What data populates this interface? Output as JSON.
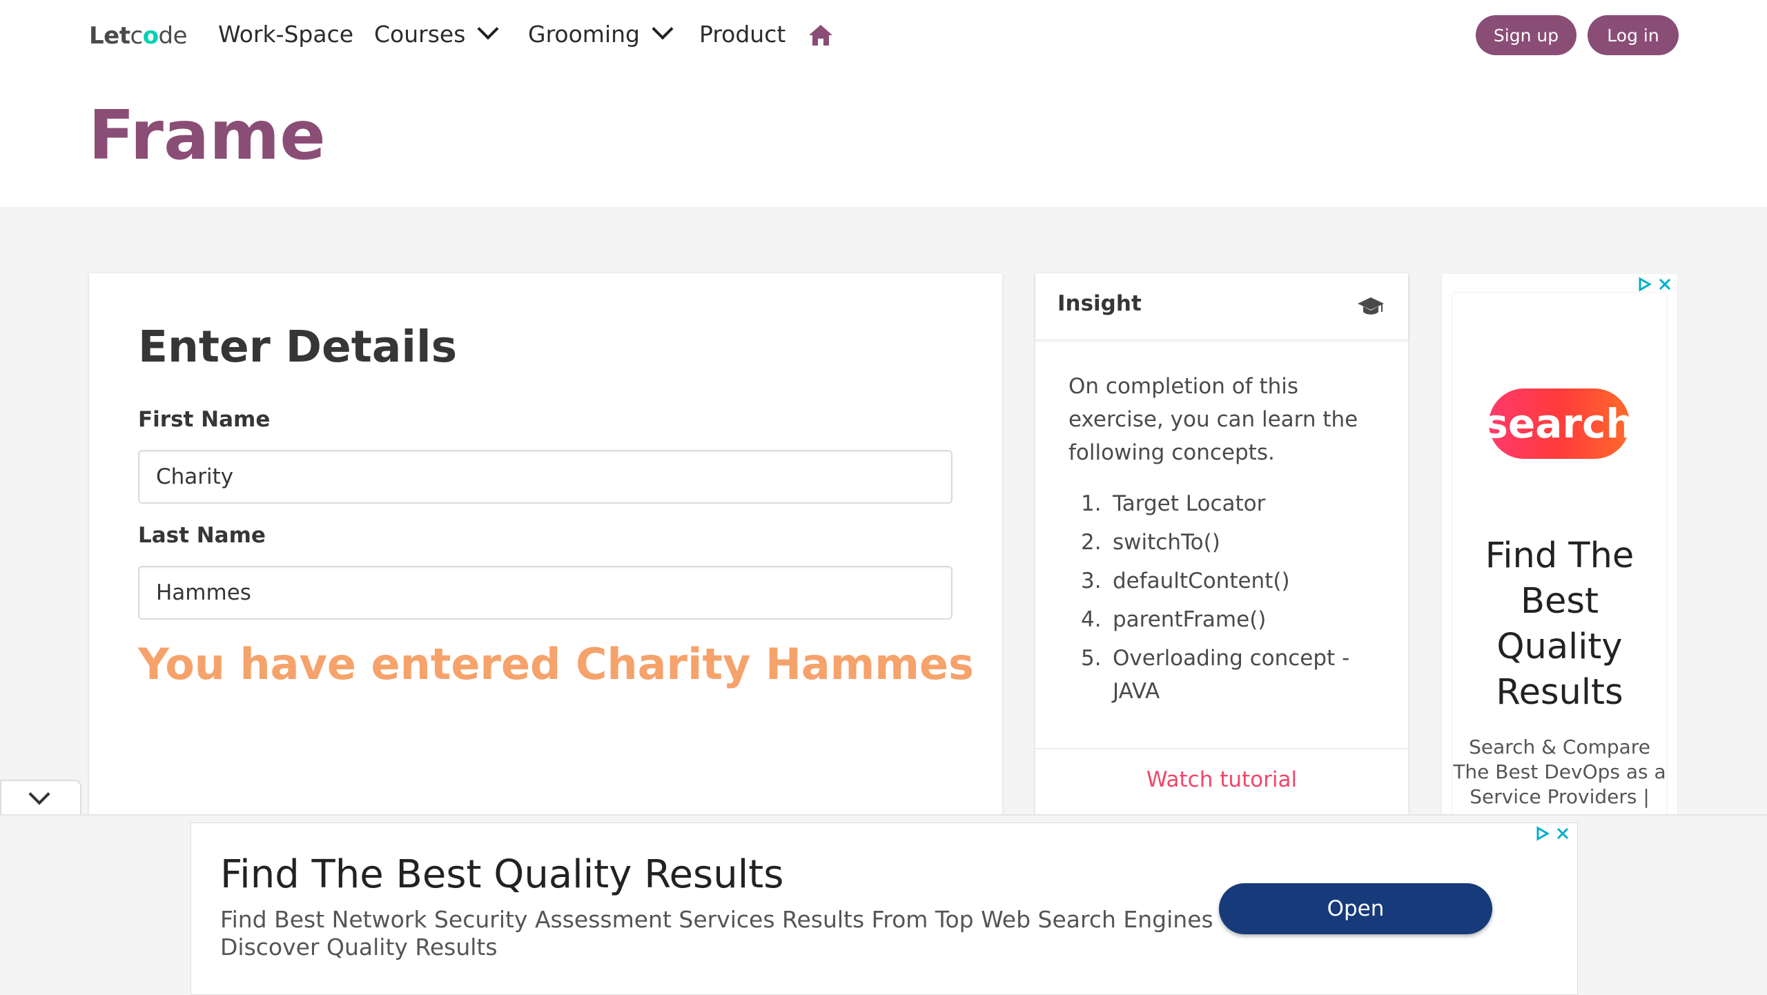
{
  "nav": {
    "logo_part1": "Let",
    "logo_part2": "c",
    "logo_part3": "o",
    "logo_part4": "de",
    "items": [
      {
        "label": "Work-Space"
      },
      {
        "label": "Courses"
      },
      {
        "label": "Grooming"
      },
      {
        "label": "Product"
      }
    ],
    "signup_label": "Sign up",
    "login_label": "Log in"
  },
  "page": {
    "title": "Frame"
  },
  "form": {
    "heading": "Enter Details",
    "first_name_label": "First Name",
    "first_name_value": "Charity",
    "last_name_label": "Last Name",
    "last_name_value": "Hammes",
    "result_text": "You have entered Charity Hammes"
  },
  "insight": {
    "title": "Insight",
    "intro": "On completion of this exercise, you can learn the following concepts.",
    "concepts": [
      {
        "num": "1.",
        "text": "Target Locator"
      },
      {
        "num": "2.",
        "text": "switchTo()"
      },
      {
        "num": "3.",
        "text": "defaultContent()"
      },
      {
        "num": "4.",
        "text": "parentFrame()"
      },
      {
        "num": "5.",
        "text": "Overloading concept - JAVA"
      }
    ],
    "footer_link": "Watch tutorial"
  },
  "side_ad": {
    "logo_text": "search",
    "headline": "Find The Best Quality Results",
    "sub": "Search & Compare The Best DevOps as a Service Providers |"
  },
  "bottom_ad": {
    "headline": "Find The Best Quality Results",
    "description": "Find Best Network Security Assessment Services Results From Top Web Search Engines Discover Quality Results",
    "button_label": "Open"
  },
  "colors": {
    "brand": "#8a4d76",
    "result": "#f6a26b",
    "link": "#f14668",
    "ad_button": "#173a7a"
  }
}
